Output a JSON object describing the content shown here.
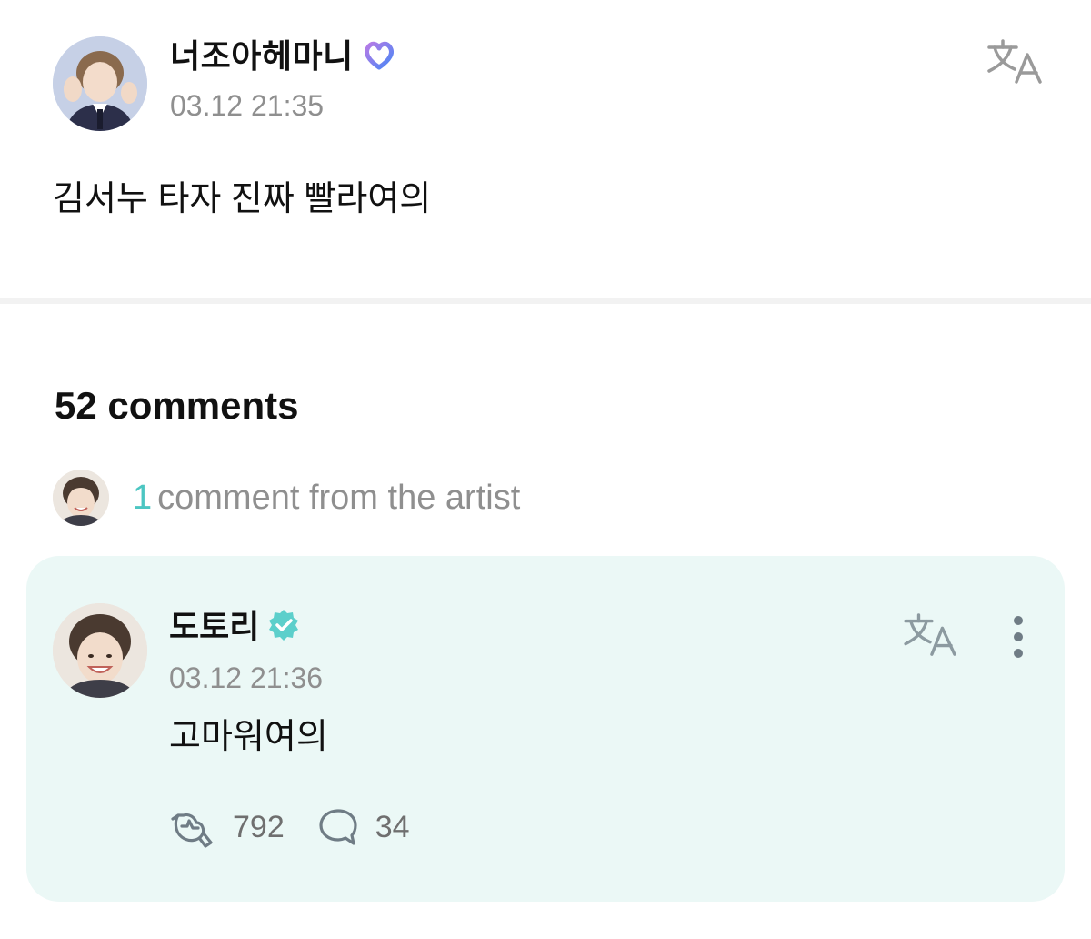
{
  "post": {
    "author_name": "너조아헤마니",
    "timestamp": "03.12 21:35",
    "body": "김서누 타자 진짜 빨라여의"
  },
  "comments": {
    "title": "52 comments",
    "artist_count": "1",
    "artist_text": "comment from the artist",
    "items": [
      {
        "author_name": "도토리",
        "timestamp": "03.12 21:36",
        "body": "고마워여의",
        "likes": "792",
        "replies": "34"
      }
    ]
  },
  "colors": {
    "card_background": "#ebf8f6",
    "accent_teal": "#4cc6c2",
    "muted_text": "#8f8f8f"
  },
  "icons": {
    "post_badge": "membership-heart-badge-icon",
    "verified": "verified-badge-icon",
    "translate": "translate-icon",
    "more": "more-vertical-icon",
    "like": "like-icon",
    "reply": "comment-bubble-icon"
  }
}
